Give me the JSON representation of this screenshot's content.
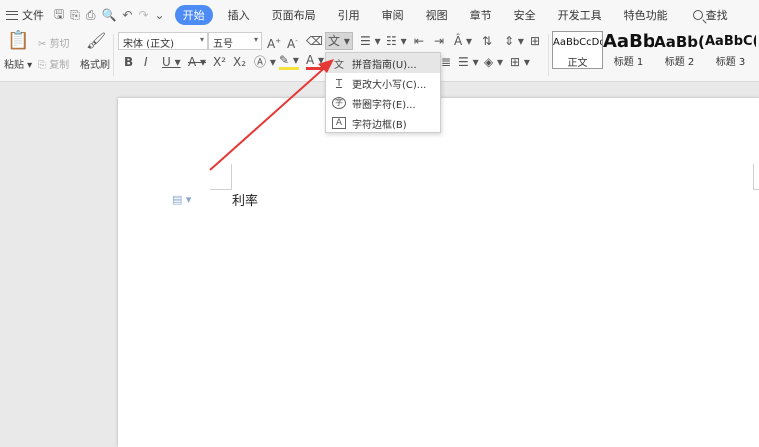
{
  "menubar": {
    "file_label": "文件",
    "tabs": [
      {
        "label": "开始",
        "active": true
      },
      {
        "label": "插入"
      },
      {
        "label": "页面布局"
      },
      {
        "label": "引用"
      },
      {
        "label": "审阅"
      },
      {
        "label": "视图"
      },
      {
        "label": "章节"
      },
      {
        "label": "安全"
      },
      {
        "label": "开发工具"
      },
      {
        "label": "特色功能"
      }
    ],
    "search_label": "查找"
  },
  "ribbon": {
    "paste_label": "粘贴",
    "cut_label": "剪切",
    "copy_label": "复制",
    "format_painter_label": "格式刷",
    "font_name": "宋体 (正文)",
    "font_size": "五号",
    "styles": [
      {
        "preview": "AaBbCcDd",
        "name": "正文",
        "selected": true
      },
      {
        "preview": "AaBb",
        "name": "标题 1"
      },
      {
        "preview": "AaBb(",
        "name": "标题 2"
      },
      {
        "preview": "AaBbC(",
        "name": "标题 3"
      }
    ]
  },
  "dropdown": {
    "items": [
      {
        "icon": "文",
        "label": "拼音指南(U)...",
        "hover": true
      },
      {
        "icon": "T",
        "label": "更改大小写(C)..."
      },
      {
        "icon": "字",
        "label": "带圈字符(E)..."
      },
      {
        "icon": "A",
        "label": "字符边框(B)"
      }
    ]
  },
  "document": {
    "text": "利率"
  },
  "colors": {
    "accent": "#4e8cf5",
    "arrow": "#e53935"
  }
}
